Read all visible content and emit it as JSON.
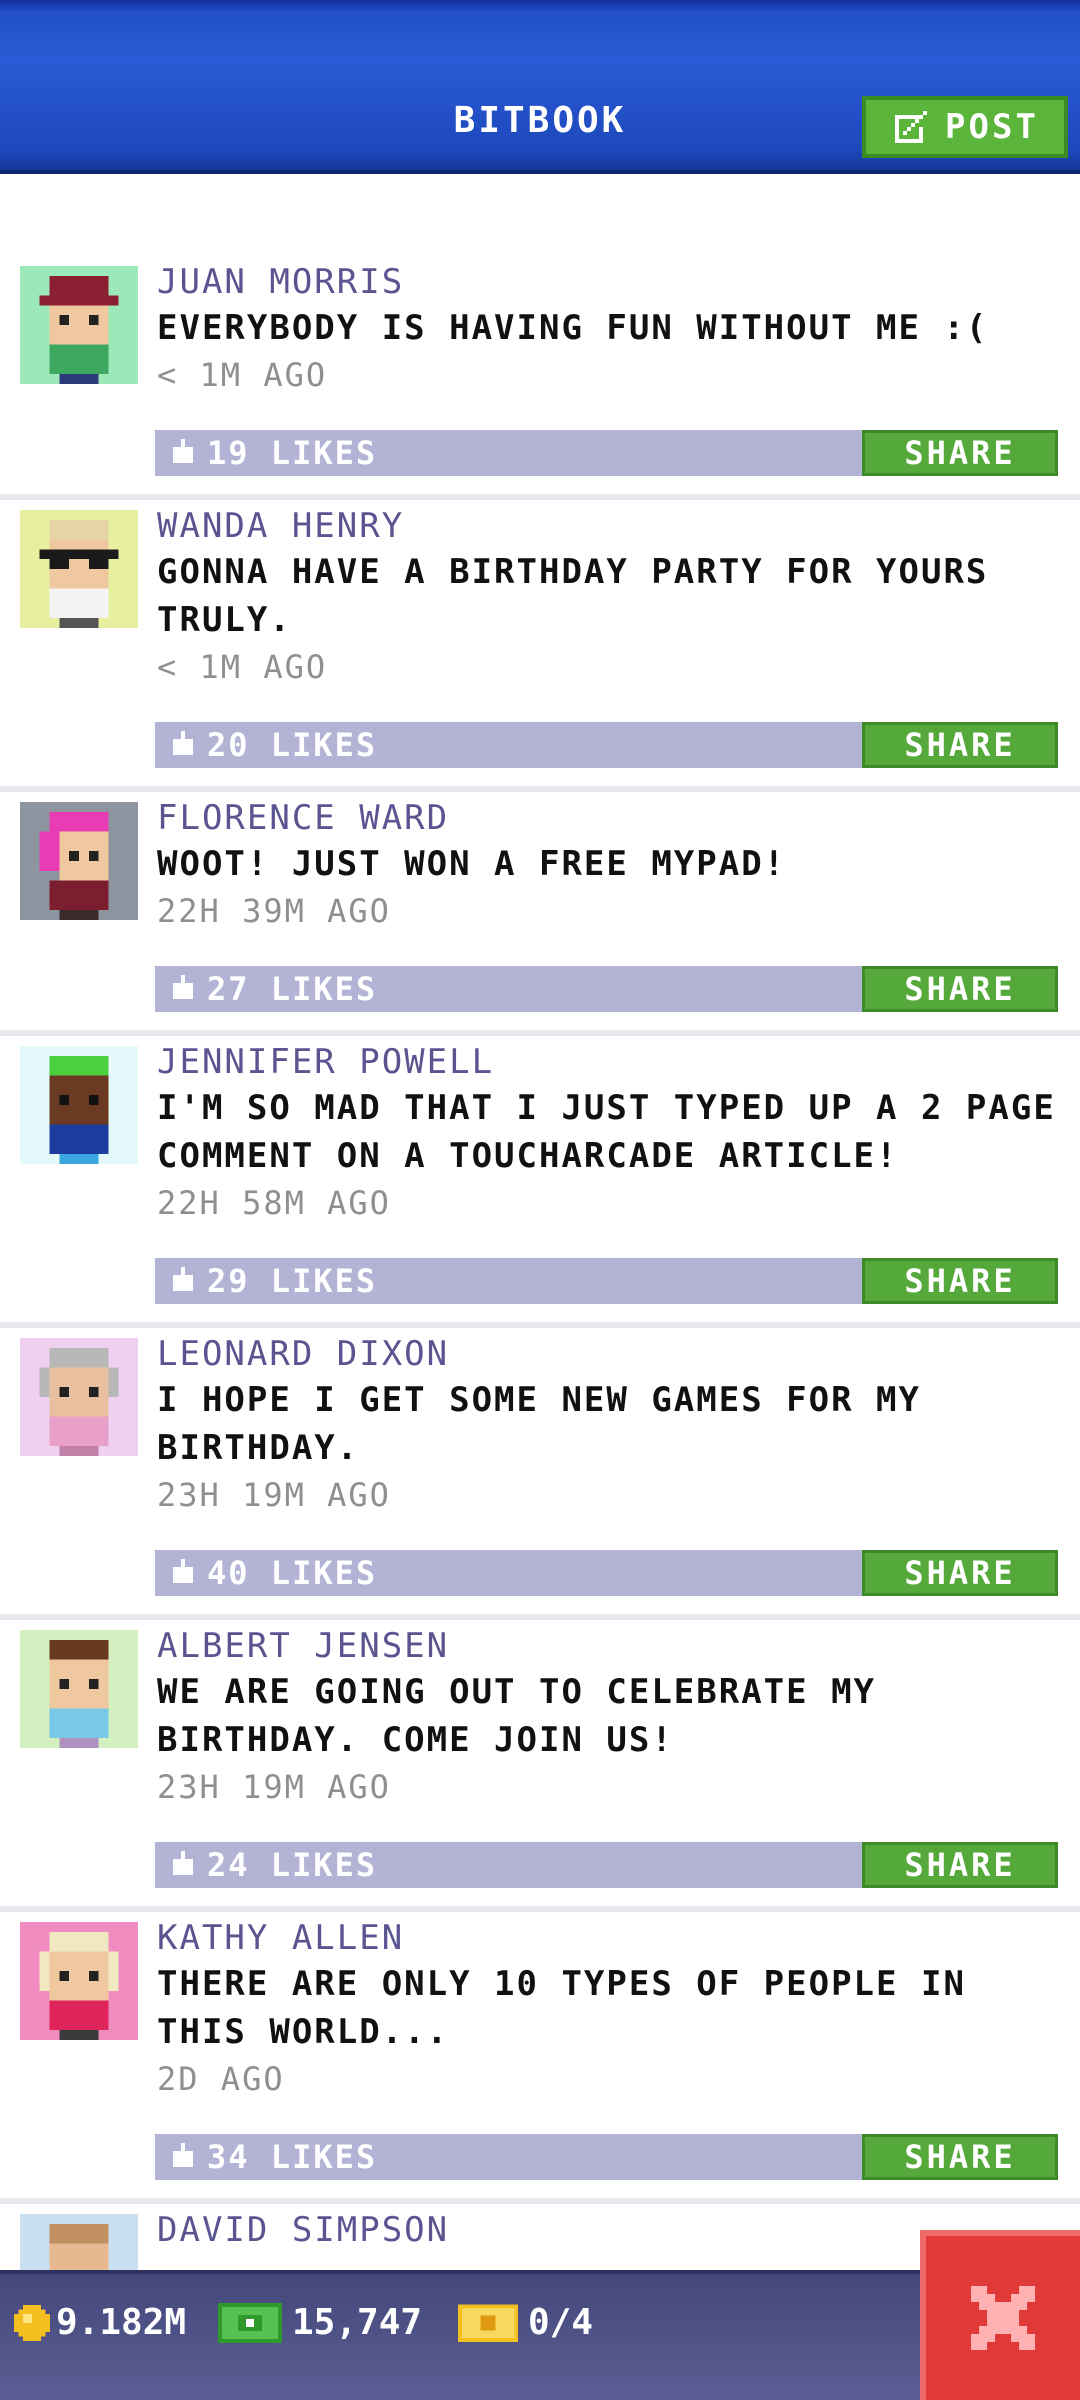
{
  "header": {
    "title": "BITBOOK",
    "post_label": "POST"
  },
  "posts": [
    {
      "name": "JUAN MORRIS",
      "message": "EVERYBODY IS HAVING FUN WITHOUT ME :(",
      "time": "< 1M AGO",
      "likes": "19 LIKES",
      "share": "SHARE"
    },
    {
      "name": "WANDA HENRY",
      "message": "GONNA HAVE A BIRTHDAY PARTY FOR YOURS TRULY.",
      "time": "< 1M AGO",
      "likes": "20 LIKES",
      "share": "SHARE"
    },
    {
      "name": "FLORENCE WARD",
      "message": "WOOT! JUST WON A FREE MYPAD!",
      "time": "22H 39M AGO",
      "likes": "27 LIKES",
      "share": "SHARE"
    },
    {
      "name": "JENNIFER POWELL",
      "message": "I'M SO MAD THAT I JUST TYPED UP A 2 PAGE COMMENT ON A TOUCHARCADE ARTICLE!",
      "time": "22H 58M AGO",
      "likes": "29 LIKES",
      "share": "SHARE"
    },
    {
      "name": "LEONARD DIXON",
      "message": "I HOPE I GET SOME NEW GAMES FOR MY BIRTHDAY.",
      "time": "23H 19M AGO",
      "likes": "40 LIKES",
      "share": "SHARE"
    },
    {
      "name": "ALBERT JENSEN",
      "message": "WE ARE GOING OUT TO CELEBRATE MY BIRTHDAY. COME JOIN US!",
      "time": "23H 19M AGO",
      "likes": "24 LIKES",
      "share": "SHARE"
    },
    {
      "name": "KATHY ALLEN",
      "message": "THERE ARE ONLY 10 TYPES OF PEOPLE IN THIS WORLD...",
      "time": "2D AGO",
      "likes": "34 LIKES",
      "share": "SHARE"
    },
    {
      "name": "DAVID SIMPSON"
    }
  ],
  "status_bar": {
    "coins": "9.182M",
    "bux": "15,747",
    "tickets": "0/4"
  },
  "icons": {
    "post": "edit-icon",
    "like": "thumbs-up-icon",
    "coin": "coin-icon",
    "bux": "cash-icon",
    "ticket": "ticket-icon",
    "close": "close-icon"
  },
  "colors": {
    "header_blue": "#2a5bd6",
    "name_purple": "#5a5490",
    "like_bar": "#b3b3d6",
    "share_green": "#55a83a",
    "close_red": "#e03a3a"
  }
}
